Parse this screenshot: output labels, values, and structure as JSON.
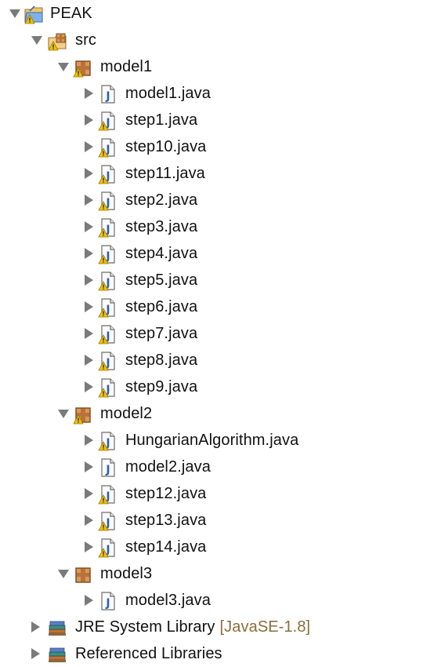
{
  "tree": {
    "project": {
      "label": "PEAK",
      "icon": "project-folder-warning-icon",
      "expanded": true
    },
    "src": {
      "label": "src",
      "icon": "source-folder-warning-icon",
      "expanded": true
    },
    "packages": [
      {
        "label": "model1",
        "icon": "package-warning-icon",
        "expanded": true,
        "files": [
          {
            "label": "model1.java",
            "icon": "java-file-icon",
            "warning": false
          },
          {
            "label": "step1.java",
            "icon": "java-file-warning-icon",
            "warning": true
          },
          {
            "label": "step10.java",
            "icon": "java-file-warning-icon",
            "warning": true
          },
          {
            "label": "step11.java",
            "icon": "java-file-warning-icon",
            "warning": true
          },
          {
            "label": "step2.java",
            "icon": "java-file-warning-icon",
            "warning": true
          },
          {
            "label": "step3.java",
            "icon": "java-file-warning-icon",
            "warning": true
          },
          {
            "label": "step4.java",
            "icon": "java-file-warning-icon",
            "warning": true
          },
          {
            "label": "step5.java",
            "icon": "java-file-warning-icon",
            "warning": true
          },
          {
            "label": "step6.java",
            "icon": "java-file-warning-icon",
            "warning": true
          },
          {
            "label": "step7.java",
            "icon": "java-file-warning-icon",
            "warning": true
          },
          {
            "label": "step8.java",
            "icon": "java-file-warning-icon",
            "warning": true
          },
          {
            "label": "step9.java",
            "icon": "java-file-warning-icon",
            "warning": true
          }
        ]
      },
      {
        "label": "model2",
        "icon": "package-warning-icon",
        "expanded": true,
        "files": [
          {
            "label": "HungarianAlgorithm.java",
            "icon": "java-file-warning-icon",
            "warning": true
          },
          {
            "label": "model2.java",
            "icon": "java-file-icon",
            "warning": false
          },
          {
            "label": "step12.java",
            "icon": "java-file-warning-icon",
            "warning": true
          },
          {
            "label": "step13.java",
            "icon": "java-file-warning-icon",
            "warning": true
          },
          {
            "label": "step14.java",
            "icon": "java-file-warning-icon",
            "warning": true
          }
        ]
      },
      {
        "label": "model3",
        "icon": "package-icon",
        "expanded": true,
        "files": [
          {
            "label": "model3.java",
            "icon": "java-file-icon",
            "warning": false
          }
        ]
      }
    ],
    "libraries": [
      {
        "label": "JRE System Library",
        "decoration": "[JavaSE-1.8]",
        "icon": "library-icon",
        "expanded": false
      },
      {
        "label": "Referenced Libraries",
        "decoration": "",
        "icon": "library-icon",
        "expanded": false
      }
    ]
  },
  "colors": {
    "arrow": "#7a7a7a",
    "decoration": "#8a6d3b",
    "java_blue": "#2b5fb4",
    "warning_yellow": "#f2c200",
    "package_brown": "#9c5a2a"
  }
}
